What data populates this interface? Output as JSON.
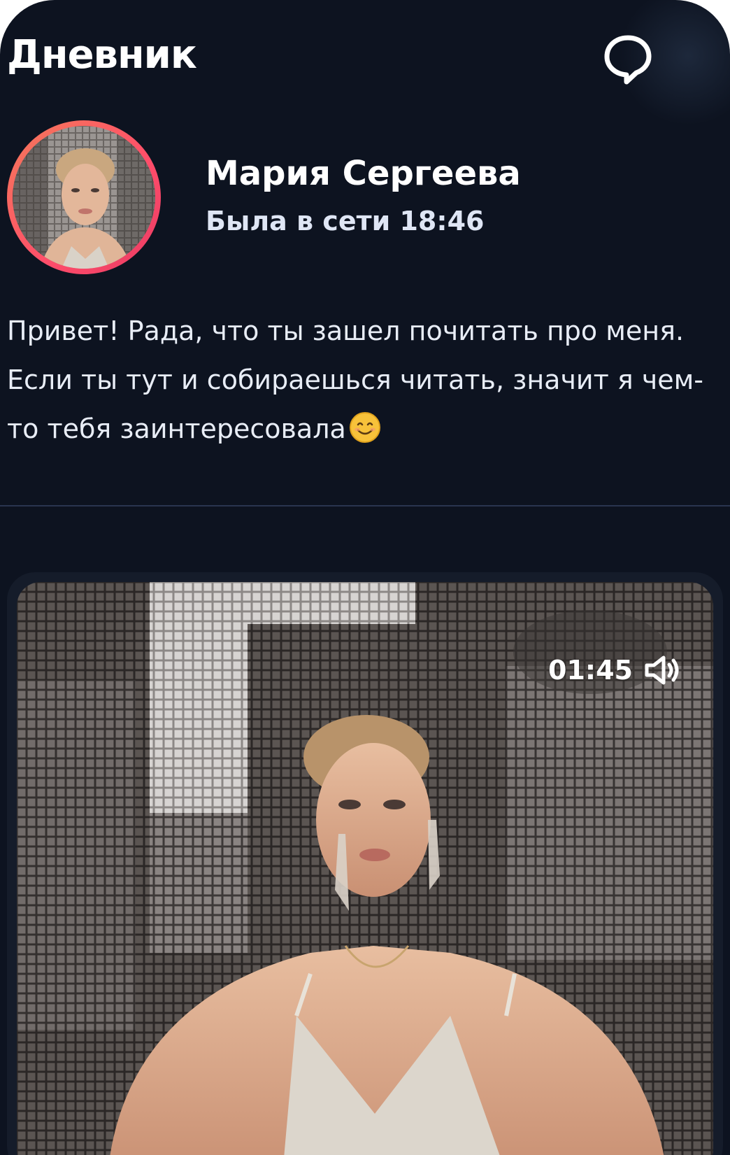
{
  "header": {
    "title": "Дневник",
    "chat_icon": "chat-bubble-icon"
  },
  "profile": {
    "name": "Мария Сергеева",
    "status": "Была в сети 18:46",
    "avatar_icon": "avatar-photo"
  },
  "about": {
    "text": "Привет! Рада, что ты зашел почитать про меня. Если ты тут и собираешься читать, значит я чем-то тебя заинтересовала",
    "emoji": "smiling-face-emoji"
  },
  "media": {
    "duration": "01:45",
    "sound_icon": "speaker-icon"
  },
  "colors": {
    "background": "#0d1320",
    "avatar_ring": "#ff4d6a",
    "text_primary": "#ffffff",
    "text_secondary": "#dfe6f5",
    "divider": "#2a3550"
  }
}
